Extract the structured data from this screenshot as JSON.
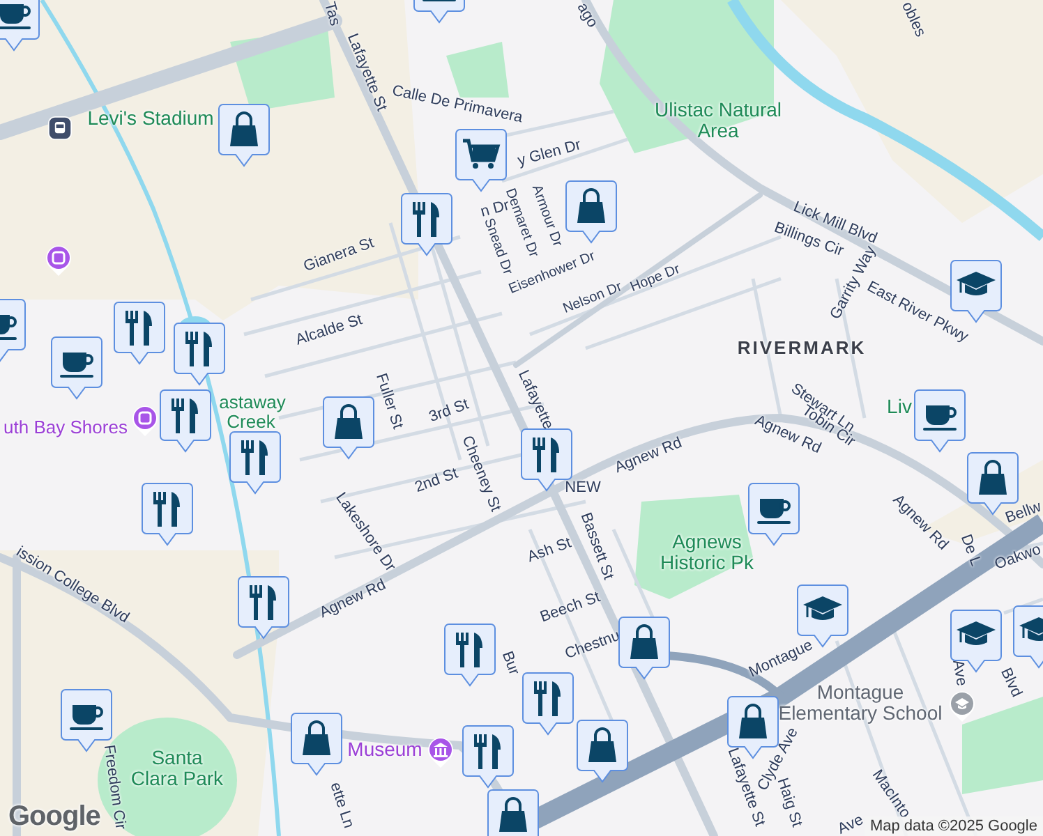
{
  "street_labels": [
    "Tas",
    "ago",
    "obles",
    "Lafayette St",
    "Calle De Primavera",
    "y Glen Dr",
    "n Dr",
    "Snead Dr",
    "Demaret Dr",
    "Armour Dr",
    "Eisenhower Dr",
    "Nelson Dr",
    "Hope Dr",
    "Lick Mill Blvd",
    "Billings Cir",
    "Garrity Way",
    "East River Pkwy",
    "Gianera St",
    "Alcalde St",
    "Fuller St",
    "3rd St",
    "Lafayette",
    "Stewart Ln",
    "Tobin Cir",
    "Agnew Rd",
    "Agnew Rd",
    "2nd St",
    "Cheeney St",
    "NEW",
    "Agnew Rd",
    "Lakeshore Dr",
    "Ash St",
    "Bassett St",
    "Beech St",
    "Bellw",
    "Oakwo",
    "De L",
    "Agnew Rd",
    "ission College Blvd",
    "Chestnu",
    "Montague",
    "Blvd",
    "Ave",
    "Bur",
    "Clyde Ave",
    "Lafayette St",
    "Haig St",
    "MacInto",
    "Freedom Cir",
    "ette Ln",
    "Ave"
  ],
  "place_labels": [
    {
      "text": "Levi's Stadium",
      "kind": "venue"
    },
    {
      "text": "Ulistac Natural Area",
      "kind": "park"
    },
    {
      "text": "RIVERMARK",
      "kind": "district"
    },
    {
      "text": "uth Bay Shores",
      "kind": "poi"
    },
    {
      "text": "astaway",
      "kind": "park"
    },
    {
      "text": "Creek",
      "kind": "park"
    },
    {
      "text": "Liv",
      "kind": "park"
    },
    {
      "text": "Agnews Historic Pk",
      "kind": "park"
    },
    {
      "text": "Montague Elementary School",
      "kind": "school"
    },
    {
      "text": "Santa Clara Park",
      "kind": "park"
    },
    {
      "text": "Museum",
      "kind": "poi"
    }
  ],
  "pins": [
    {
      "kind": "cafe"
    },
    {
      "kind": "cafe"
    },
    {
      "kind": "shopping"
    },
    {
      "kind": "grocery"
    },
    {
      "kind": "restaurant"
    },
    {
      "kind": "shopping"
    },
    {
      "kind": "restaurant"
    },
    {
      "kind": "restaurant"
    },
    {
      "kind": "cafe"
    },
    {
      "kind": "restaurant"
    },
    {
      "kind": "shopping"
    },
    {
      "kind": "restaurant"
    },
    {
      "kind": "school"
    },
    {
      "kind": "restaurant"
    },
    {
      "kind": "restaurant"
    },
    {
      "kind": "restaurant"
    },
    {
      "kind": "cafe"
    },
    {
      "kind": "cafe"
    },
    {
      "kind": "shopping"
    },
    {
      "kind": "school"
    },
    {
      "kind": "school"
    },
    {
      "kind": "shopping"
    },
    {
      "kind": "restaurant"
    },
    {
      "kind": "restaurant"
    },
    {
      "kind": "restaurant"
    },
    {
      "kind": "shopping"
    },
    {
      "kind": "shopping"
    },
    {
      "kind": "cafe"
    },
    {
      "kind": "shopping"
    },
    {
      "kind": "shopping"
    },
    {
      "kind": "school"
    },
    {
      "kind": "cafe"
    }
  ],
  "logo": "Google",
  "attribution": "Map data ©2025 Google"
}
